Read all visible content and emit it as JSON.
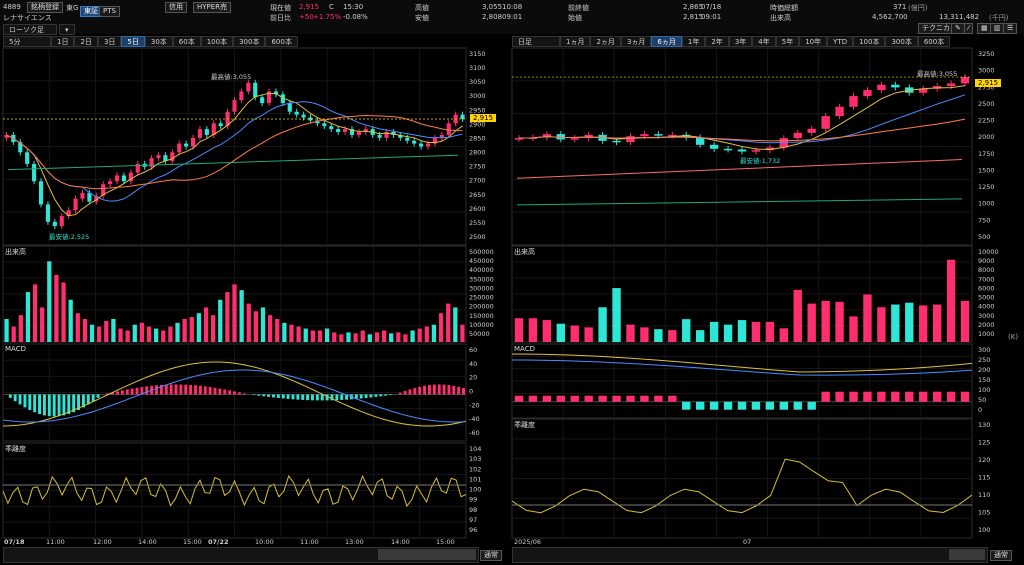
{
  "header": {
    "code": "4889",
    "register_label": "銘柄登録",
    "market": "東G",
    "company": "レナサイエンス",
    "exchange_tabs": [
      "東証",
      "PTS"
    ],
    "credit_label": "信用",
    "hyper_label": "HYPER売",
    "quote": {
      "current_label": "現在値",
      "current": "2,915",
      "current_flag": "C",
      "current_time": "15:30",
      "change_label": "前日比",
      "change": "+50",
      "change_pct": "+1.75%",
      "change_pct2": "-0.08%",
      "high_label": "高値",
      "high": "3,055",
      "high_time": "10:08",
      "low_label": "安値",
      "low": "2,808",
      "low_time": "09:01",
      "prev_close_label": "前終値",
      "prev_close": "2,865",
      "prev_close_date": "07/18",
      "open_label": "始値",
      "open": "2,815",
      "open_time": "09:01",
      "market_cap_label": "時価総額",
      "market_cap": "371",
      "market_cap_unit": "(億円)",
      "volume_label": "出来高",
      "volume": "4,562,700",
      "turnover": "13,311,482",
      "turnover_unit": "(千円)"
    },
    "technical_label": "テクニカル"
  },
  "left": {
    "chart_type": "ローソク足",
    "period": "5分",
    "tabs": [
      "1日",
      "2日",
      "3日",
      "5日",
      "30本",
      "60本",
      "100本",
      "300本",
      "600本"
    ],
    "active_tab": "5日",
    "price_label": "2,915",
    "high_annot": "最高値:3,055",
    "low_annot": "最安値:2,525",
    "price_ticks": [
      "3150",
      "3100",
      "3050",
      "3000",
      "2950",
      "2900",
      "2850",
      "2800",
      "2750",
      "2700",
      "2650",
      "2600",
      "2550",
      "2500"
    ],
    "volume_title": "出来高",
    "volume_ticks": [
      "500000",
      "450000",
      "400000",
      "350000",
      "300000",
      "250000",
      "200000",
      "150000",
      "100000",
      "50000"
    ],
    "macd_title": "MACD",
    "macd_ticks": [
      "60",
      "40",
      "20",
      "0",
      "-20",
      "-40",
      "-60"
    ],
    "dev_title": "乖離度",
    "dev_ticks": [
      "104",
      "103",
      "102",
      "101",
      "100",
      "99",
      "98",
      "97",
      "96"
    ],
    "time_labels": [
      "07/18",
      "11:00",
      "12:00",
      "14:00",
      "15:00",
      "07/22",
      "10:00",
      "11:00",
      "13:00",
      "14:00",
      "15:00"
    ],
    "scroll_select": "通常"
  },
  "right": {
    "chart_type": "日足",
    "tabs": [
      "1ヵ月",
      "2ヵ月",
      "3ヵ月",
      "6ヵ月",
      "1年",
      "2年",
      "3年",
      "4年",
      "5年",
      "10年",
      "YTD",
      "100本",
      "300本",
      "600本"
    ],
    "active_tab": "6ヵ月",
    "price_label": "2,915",
    "high_annot": "最高値:3,055",
    "low_annot": "最安値:1,732",
    "price_ticks": [
      "3250",
      "3000",
      "2750",
      "2500",
      "2250",
      "2000",
      "1750",
      "1500",
      "1250",
      "1000",
      "750",
      "500"
    ],
    "volume_title": "出来高",
    "volume_ticks": [
      "10000",
      "9000",
      "8000",
      "7000",
      "6000",
      "5000",
      "4000",
      "3000",
      "2000",
      "1000"
    ],
    "volume_unit": "(K)",
    "macd_title": "MACD",
    "macd_ticks": [
      "300",
      "250",
      "200",
      "150",
      "100",
      "50",
      "0"
    ],
    "dev_title": "乖離度",
    "dev_ticks": [
      "130",
      "125",
      "120",
      "115",
      "110",
      "105",
      "100"
    ],
    "time_labels": [
      "2025/06",
      "07"
    ],
    "scroll_select": "通常"
  },
  "colors": {
    "up": "#ff2e6e",
    "down": "#2ee6d6",
    "accent_label": "#ffd400",
    "grid": "#1c1c1c"
  },
  "chart_data": [
    {
      "type": "candlestick",
      "name_ref": "left 5-minute chart",
      "values": [
        2860,
        2835,
        2800,
        2760,
        2700,
        2620,
        2560,
        2545,
        2580,
        2600,
        2640,
        2660,
        2630,
        2650,
        2690,
        2700,
        2720,
        2700,
        2730,
        2760,
        2750,
        2780,
        2790,
        2770,
        2800,
        2830,
        2820,
        2850,
        2880,
        2860,
        2900,
        2890,
        2940,
        2980,
        3010,
        3040,
        2990,
        2970,
        3010,
        3000,
        2970,
        2940,
        2930,
        2920,
        2910,
        2900,
        2890,
        2880,
        2870,
        2880,
        2860,
        2870,
        2880,
        2860,
        2850,
        2870,
        2860,
        2850,
        2840,
        2830,
        2820,
        2830,
        2850,
        2860,
        2900,
        2930,
        2915
      ],
      "ylim": [
        2480,
        3160
      ]
    },
    {
      "type": "bar",
      "name_ref": "left volume",
      "values": [
        120000,
        80000,
        140000,
        260000,
        300000,
        180000,
        420000,
        350000,
        310000,
        220000,
        150000,
        120000,
        90000,
        80000,
        110000,
        120000,
        70000,
        60000,
        90000,
        100000,
        80000,
        70000,
        60000,
        80000,
        100000,
        120000,
        130000,
        150000,
        180000,
        140000,
        220000,
        260000,
        300000,
        270000,
        200000,
        160000,
        180000,
        140000,
        120000,
        100000,
        90000,
        80000,
        70000,
        60000,
        60000,
        70000,
        50000,
        40000,
        50000,
        45000,
        60000,
        40000,
        50000,
        60000,
        45000,
        50000,
        40000,
        60000,
        70000,
        80000,
        90000,
        150000,
        200000,
        180000,
        90000
      ],
      "ylim": [
        0,
        500000
      ]
    },
    {
      "type": "candlestick",
      "name_ref": "right daily chart",
      "values": [
        2000,
        2010,
        2060,
        1980,
        2000,
        2050,
        1960,
        1940,
        2030,
        2060,
        2040,
        2050,
        2010,
        1900,
        1840,
        1830,
        1800,
        1820,
        1860,
        2000,
        2080,
        2140,
        2330,
        2470,
        2630,
        2720,
        2800,
        2760,
        2680,
        2740,
        2780,
        2820,
        2915
      ],
      "ylim": [
        400,
        3350
      ]
    },
    {
      "type": "bar",
      "name_ref": "right volume",
      "values": [
        2600,
        2600,
        2400,
        2000,
        1800,
        1600,
        3800,
        5900,
        1900,
        1600,
        1400,
        1300,
        2500,
        1300,
        2200,
        1900,
        2400,
        2200,
        2200,
        1500,
        5700,
        4200,
        4500,
        4400,
        2800,
        5200,
        3800,
        4100,
        4300,
        4000,
        4100,
        9000,
        4500
      ],
      "ylim": [
        0,
        10500
      ]
    }
  ]
}
